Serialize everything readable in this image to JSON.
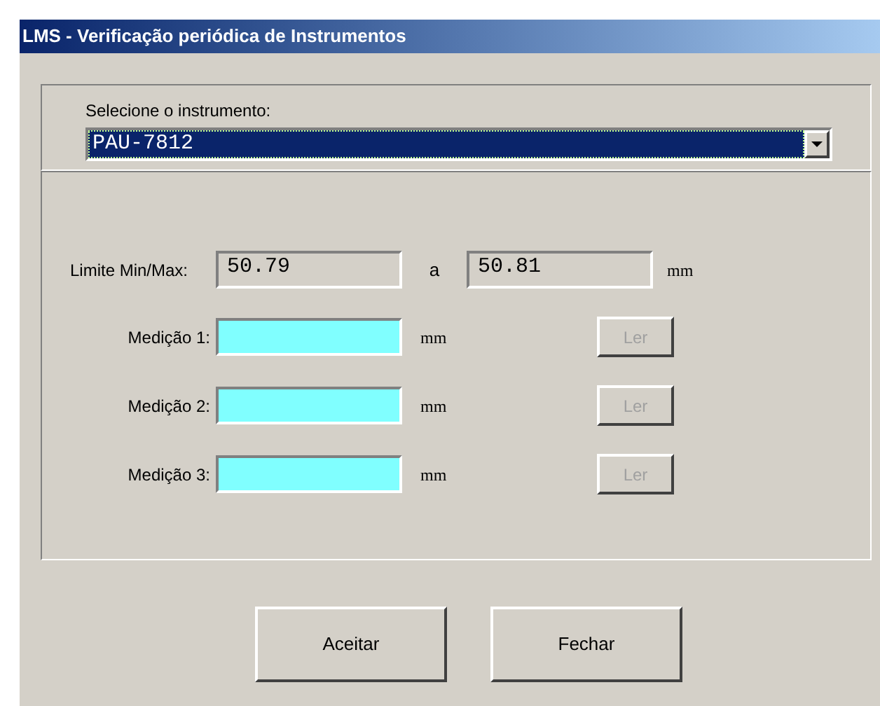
{
  "window": {
    "title": "LMS - Verificação periódica de Instrumentos"
  },
  "instrument": {
    "label": "Selecione o instrumento:",
    "value": "PAU-7812"
  },
  "limits": {
    "label": "Limite Min/Max:",
    "min": "50.79",
    "separator": "a",
    "max": "50.81",
    "unit": "mm"
  },
  "measurements": [
    {
      "label": "Medição 1:",
      "unit": "mm",
      "button": "Ler",
      "disabled": true
    },
    {
      "label": "Medição 2:",
      "unit": "mm",
      "button": "Ler",
      "disabled": true
    },
    {
      "label": "Medição 3:",
      "unit": "mm",
      "button": "Ler",
      "disabled": true
    }
  ],
  "buttons": [
    "Aceitar",
    "Fechar"
  ]
}
